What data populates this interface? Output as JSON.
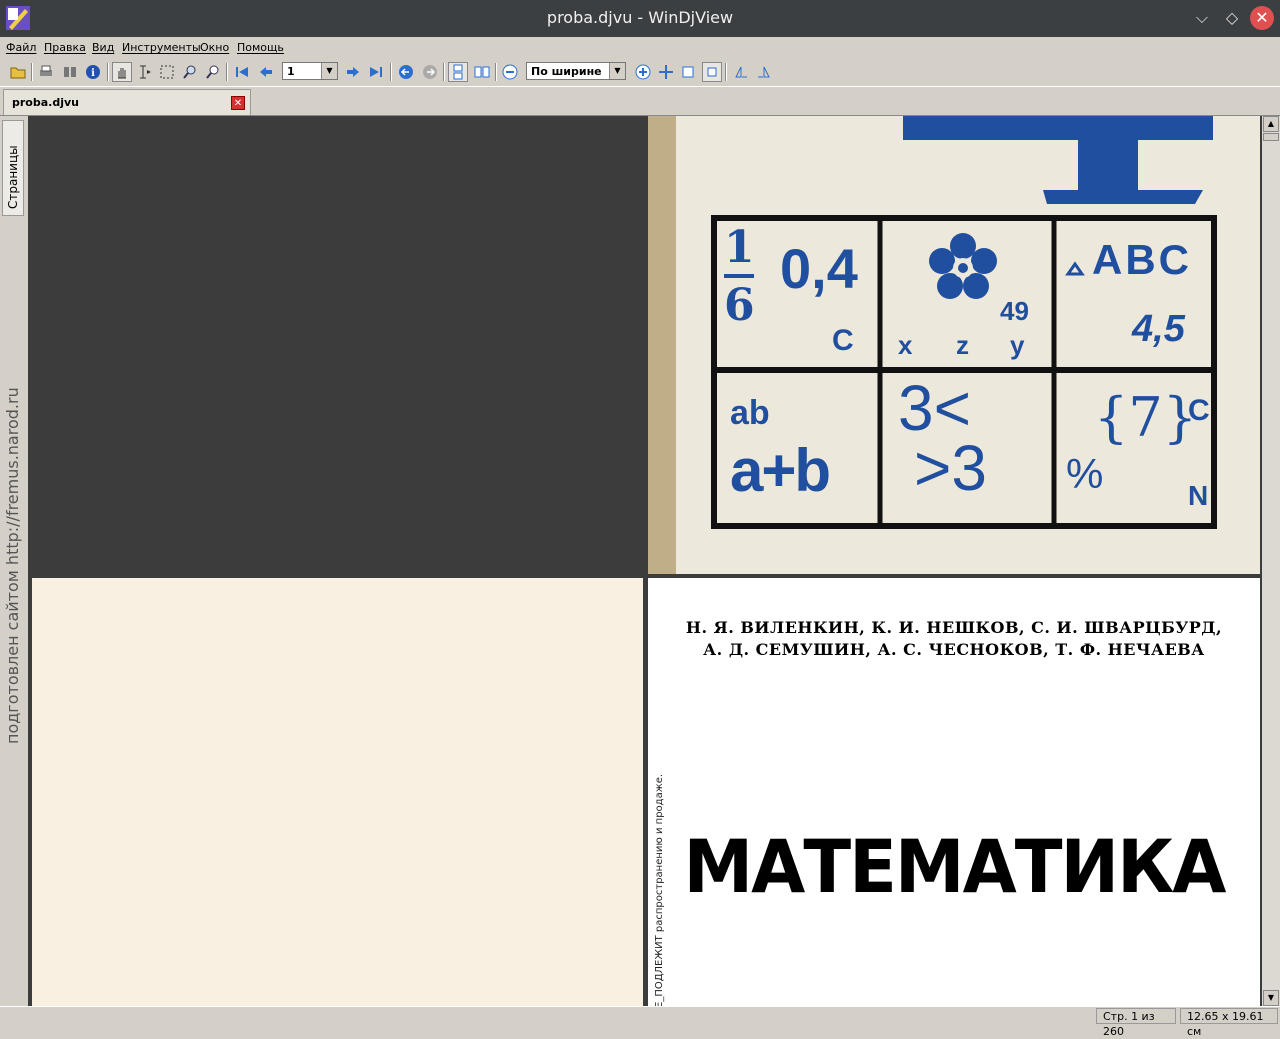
{
  "window": {
    "title": "proba.djvu - WinDjView",
    "controls": [
      "minimize",
      "maximize",
      "close"
    ]
  },
  "menu": [
    "Файл",
    "Правка",
    "Вид",
    "Инструменты",
    "Окно",
    "Помощь"
  ],
  "toolbar": {
    "page_number": "1",
    "zoom_mode": "По ширине"
  },
  "tab": {
    "label": "proba.djvu"
  },
  "sidebar": {
    "pages_tab": "Страницы",
    "watermark": "подготовлен сайтом http://fremus.narod.ru"
  },
  "cover": {
    "cells": [
      {
        "items": [
          "1",
          "6",
          "0,4",
          "C"
        ]
      },
      {
        "items": [
          "49",
          "x",
          "z",
          "y"
        ]
      },
      {
        "items": [
          "ABC",
          "4,5"
        ]
      },
      {
        "items": [
          "ab",
          "a+b"
        ]
      },
      {
        "items": [
          "3<",
          ">3"
        ]
      },
      {
        "items": [
          "{7}",
          "C",
          "%",
          "N"
        ]
      }
    ]
  },
  "title_page": {
    "authors_line1": "Н. Я. ВИЛЕНКИН, К. И. НЕШКОВ, С. И. ШВАРЦБУРД,",
    "authors_line2": "А. Д. СЕМУШИН, А. С. ЧЕСНОКОВ, Т. Ф. НЕЧАЕВА",
    "book_title": "МАТЕМАТИКА",
    "side_note": "Е_ПОДЛЕЖИТ распространению и продаже."
  },
  "status": {
    "page": "Стр. 1 из 260",
    "size": "12.65 x 19.61 см"
  },
  "colors": {
    "accent_blue": "#1f4f9e",
    "cover_bg": "#ede8dc",
    "viewer_bg": "#3c3c3c"
  }
}
